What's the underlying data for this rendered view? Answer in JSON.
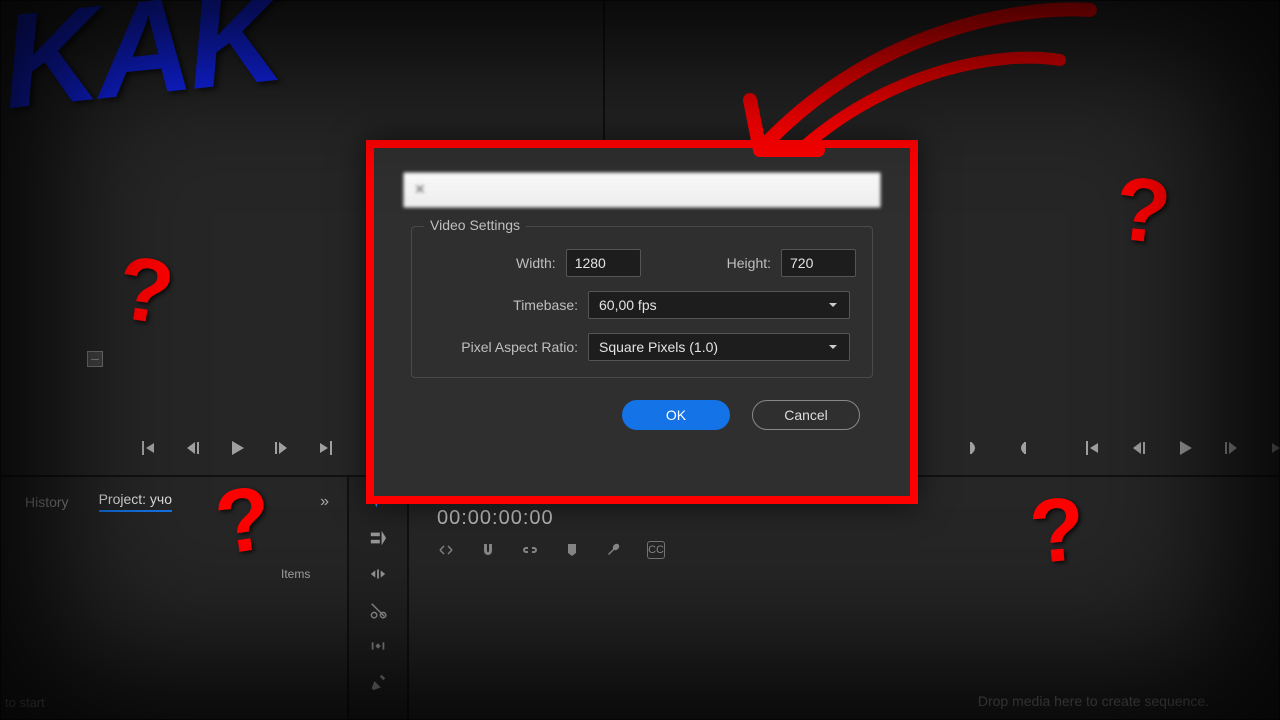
{
  "overlay": {
    "kak": "KAK",
    "question": "?"
  },
  "dialog": {
    "fieldset_title": "Video Settings",
    "width_label": "Width:",
    "width_value": "1280",
    "height_label": "Height:",
    "height_value": "720",
    "timebase_label": "Timebase:",
    "timebase_value": "60,00 fps",
    "par_label": "Pixel Aspect Ratio:",
    "par_value": "Square Pixels (1.0)",
    "ok": "OK",
    "cancel": "Cancel"
  },
  "tabs": {
    "history": "History",
    "project": "Project: учо",
    "items": "Items"
  },
  "timeline": {
    "timecode": "00:00:00:00",
    "cc": "CC",
    "drop_hint": "Drop media here to create sequence."
  },
  "hints": {
    "bottom_left": "to start"
  }
}
